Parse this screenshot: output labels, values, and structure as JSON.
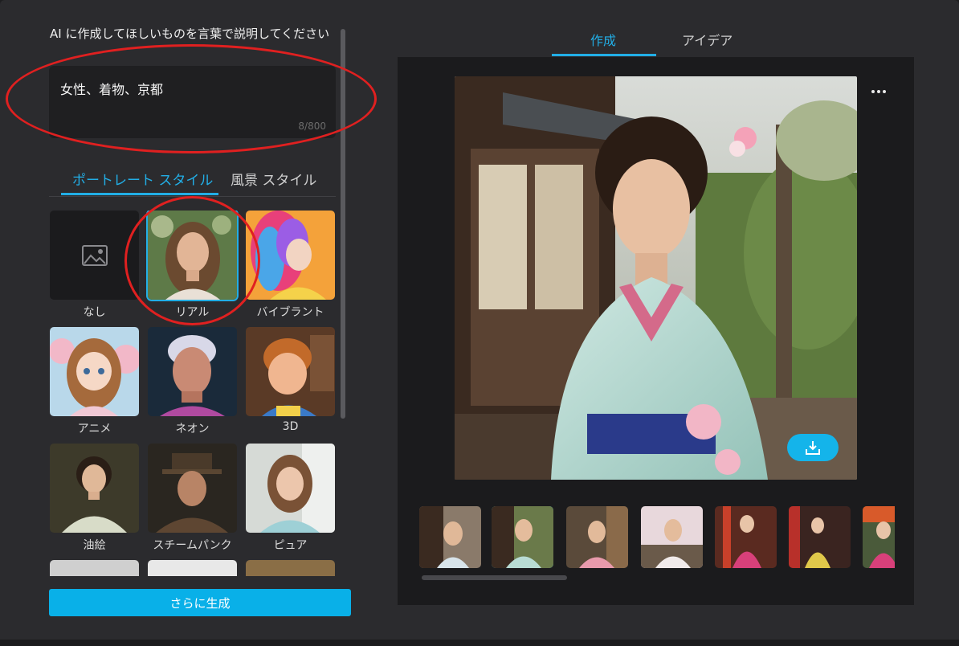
{
  "prompt": {
    "label": "AI に作成してほしいものを言葉で説明してください",
    "value": "女性、着物、京都",
    "char_count": "8/800"
  },
  "style_tabs": [
    {
      "label": "ポートレート スタイル",
      "active": true
    },
    {
      "label": "風景 スタイル",
      "active": false
    }
  ],
  "styles": [
    {
      "label": "なし"
    },
    {
      "label": "リアル",
      "selected": true
    },
    {
      "label": "バイブラント"
    },
    {
      "label": "アニメ"
    },
    {
      "label": "ネオン"
    },
    {
      "label": "3D"
    },
    {
      "label": "油絵"
    },
    {
      "label": "スチームパンク"
    },
    {
      "label": "ピュア"
    }
  ],
  "generate_button": "さらに生成",
  "top_tabs": [
    {
      "label": "作成",
      "active": true
    },
    {
      "label": "アイデア",
      "active": false
    }
  ],
  "thumbnails_selected_index": 1,
  "colors": {
    "accent": "#22aee6",
    "button": "#09b0e8",
    "annotation": "#e02020"
  }
}
